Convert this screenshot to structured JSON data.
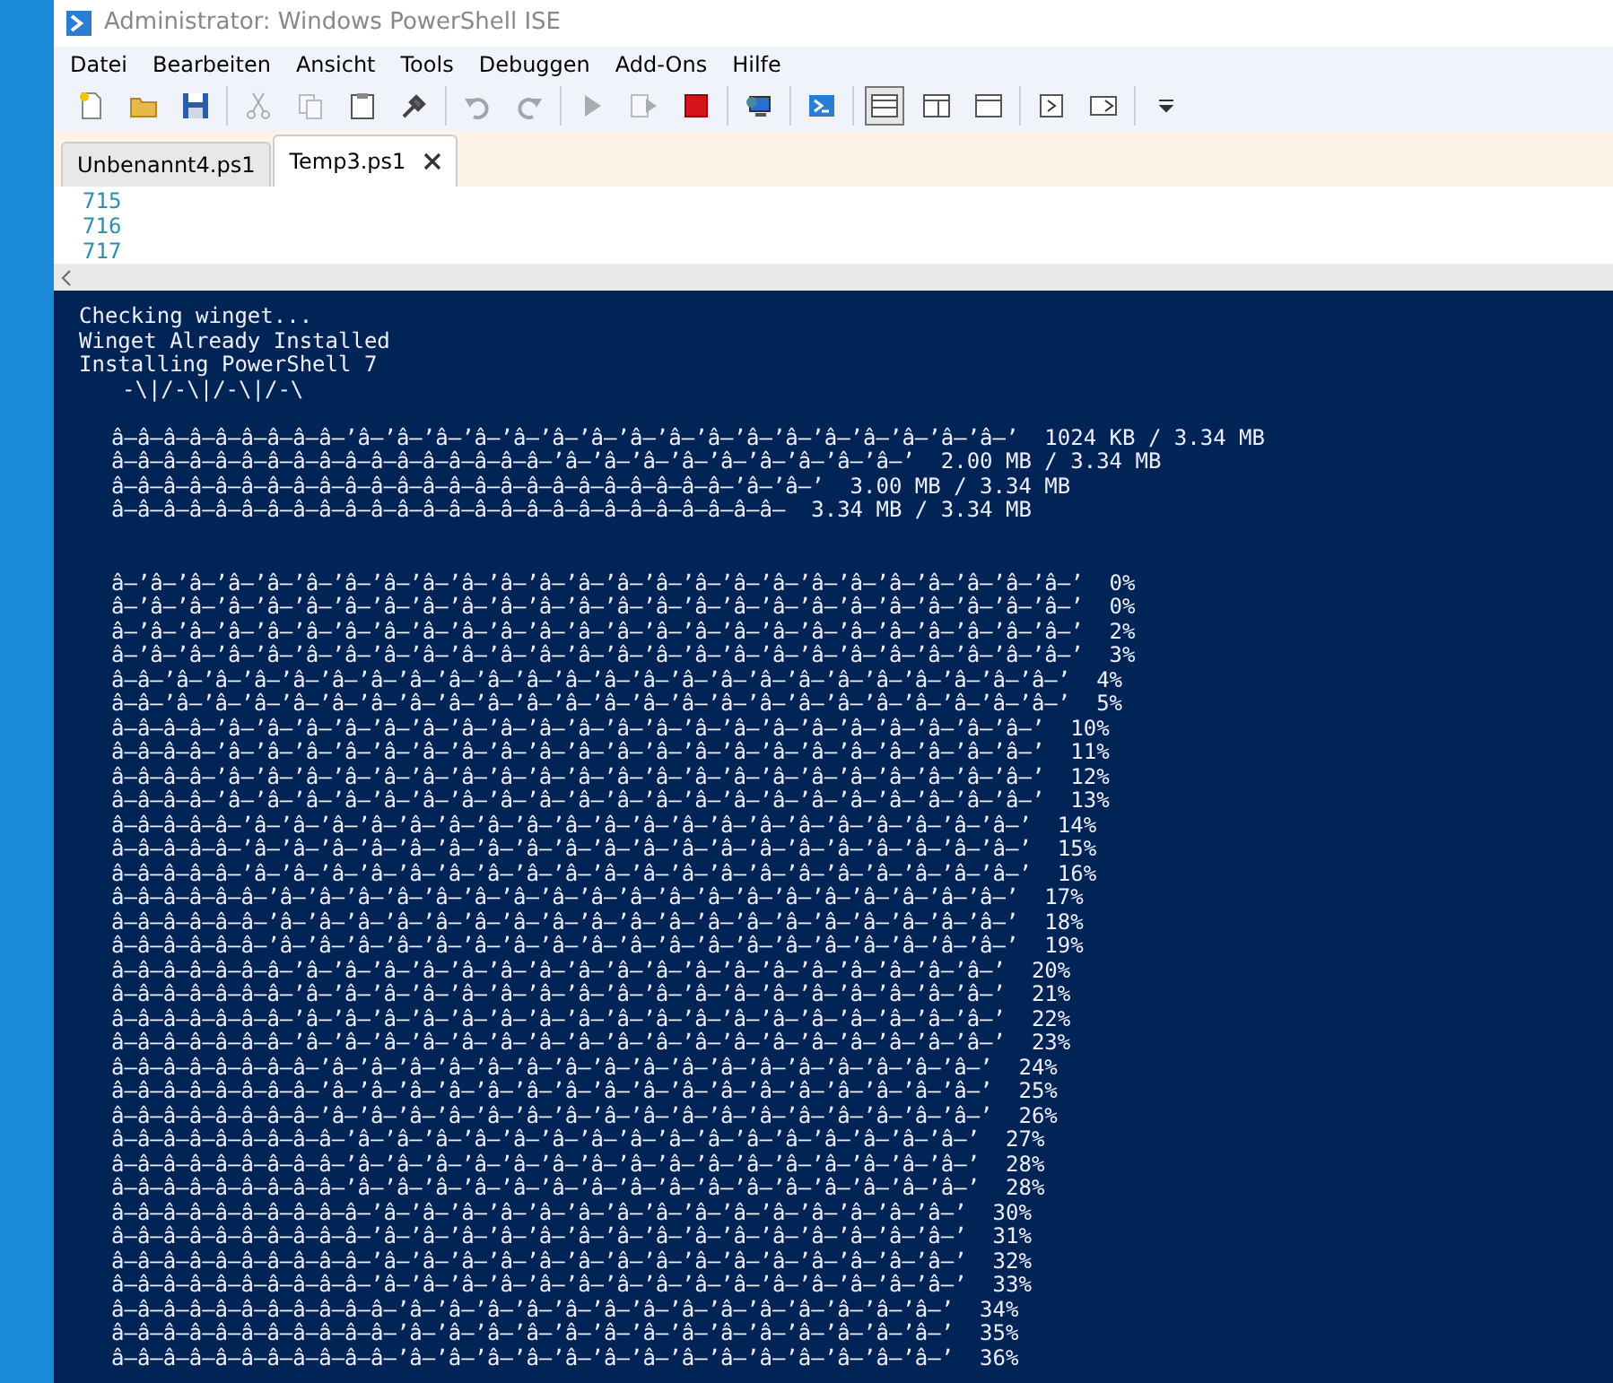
{
  "window": {
    "title": "Administrator: Windows PowerShell ISE"
  },
  "menu": [
    "Datei",
    "Bearbeiten",
    "Ansicht",
    "Tools",
    "Debuggen",
    "Add-Ons",
    "Hilfe"
  ],
  "toolbar": [
    [
      {
        "kind": "new",
        "disabled": false
      },
      {
        "kind": "open",
        "disabled": false
      },
      {
        "kind": "save",
        "disabled": false
      }
    ],
    [
      {
        "kind": "cut",
        "disabled": true
      },
      {
        "kind": "copy",
        "disabled": true
      },
      {
        "kind": "paste",
        "disabled": false
      },
      {
        "kind": "clear",
        "disabled": false
      }
    ],
    [
      {
        "kind": "undo",
        "disabled": true
      },
      {
        "kind": "redo",
        "disabled": true
      }
    ],
    [
      {
        "kind": "run",
        "disabled": true
      },
      {
        "kind": "runsel",
        "disabled": true
      },
      {
        "kind": "stop",
        "disabled": false
      }
    ],
    [
      {
        "kind": "remote",
        "disabled": false
      }
    ],
    [
      {
        "kind": "shell",
        "disabled": false
      }
    ],
    [
      {
        "kind": "layout-top",
        "disabled": false,
        "selected": true
      },
      {
        "kind": "layout-right",
        "disabled": false,
        "selected": false
      },
      {
        "kind": "layout-max",
        "disabled": false,
        "selected": false
      }
    ],
    [
      {
        "kind": "commands",
        "disabled": false
      },
      {
        "kind": "addon",
        "disabled": false
      }
    ],
    [
      {
        "kind": "overflow",
        "disabled": false
      }
    ]
  ],
  "tabs": [
    {
      "label": "Unbenannt4.ps1",
      "selected": false
    },
    {
      "label": "Temp3.ps1",
      "selected": true
    }
  ],
  "editor": {
    "line_numbers": [
      "715",
      "716",
      "717"
    ]
  },
  "console": {
    "lines": [
      {
        "kind": "text",
        "text": "Checking winget..."
      },
      {
        "kind": "text",
        "text": "Winget Already Installed"
      },
      {
        "kind": "text",
        "text": "Installing PowerShell 7"
      },
      {
        "kind": "spinner",
        "text": "-\\|/-\\|/-\\|/-\\"
      },
      {
        "kind": "blank"
      },
      {
        "kind": "bar",
        "text": "â–â–â–â–â–â–â–â–â–’â–’â–’â–’â–’â–’â–’â–’â–’â–’â–’â–’â–’â–’â–’â–’â–’â–’  1024 KB / 3.34 MB"
      },
      {
        "kind": "bar",
        "text": "â–â–â–â–â–â–â–â–â–â–â–â–â–â–â–â–â–’â–’â–’â–’â–’â–’â–’â–’â–’â–’  2.00 MB / 3.34 MB"
      },
      {
        "kind": "bar",
        "text": "â–â–â–â–â–â–â–â–â–â–â–â–â–â–â–â–â–â–â–â–â–â–â–â–’â–’â–’  3.00 MB / 3.34 MB"
      },
      {
        "kind": "bar",
        "text": "â–â–â–â–â–â–â–â–â–â–â–â–â–â–â–â–â–â–â–â–â–â–â–â–â–â–  3.34 MB / 3.34 MB"
      },
      {
        "kind": "blank"
      },
      {
        "kind": "blank"
      },
      {
        "kind": "bar",
        "text": "â–’â–’â–’â–’â–’â–’â–’â–’â–’â–’â–’â–’â–’â–’â–’â–’â–’â–’â–’â–’â–’â–’â–’â–’â–’  0%"
      },
      {
        "kind": "bar",
        "text": "â–’â–’â–’â–’â–’â–’â–’â–’â–’â–’â–’â–’â–’â–’â–’â–’â–’â–’â–’â–’â–’â–’â–’â–’â–’  0%"
      },
      {
        "kind": "bar",
        "text": "â–’â–’â–’â–’â–’â–’â–’â–’â–’â–’â–’â–’â–’â–’â–’â–’â–’â–’â–’â–’â–’â–’â–’â–’â–’  2%"
      },
      {
        "kind": "bar",
        "text": "â–’â–’â–’â–’â–’â–’â–’â–’â–’â–’â–’â–’â–’â–’â–’â–’â–’â–’â–’â–’â–’â–’â–’â–’â–’  3%"
      },
      {
        "kind": "bar",
        "text": "â–â–’â–’â–’â–’â–’â–’â–’â–’â–’â–’â–’â–’â–’â–’â–’â–’â–’â–’â–’â–’â–’â–’â–’â–’  4%"
      },
      {
        "kind": "bar",
        "text": "â–â–’â–’â–’â–’â–’â–’â–’â–’â–’â–’â–’â–’â–’â–’â–’â–’â–’â–’â–’â–’â–’â–’â–’â–’  5%"
      },
      {
        "kind": "bar",
        "text": "â–â–â–â–’â–’â–’â–’â–’â–’â–’â–’â–’â–’â–’â–’â–’â–’â–’â–’â–’â–’â–’â–’â–’â–’  10%"
      },
      {
        "kind": "bar",
        "text": "â–â–â–â–’â–’â–’â–’â–’â–’â–’â–’â–’â–’â–’â–’â–’â–’â–’â–’â–’â–’â–’â–’â–’â–’  11%"
      },
      {
        "kind": "bar",
        "text": "â–â–â–â–’â–’â–’â–’â–’â–’â–’â–’â–’â–’â–’â–’â–’â–’â–’â–’â–’â–’â–’â–’â–’â–’  12%"
      },
      {
        "kind": "bar",
        "text": "â–â–â–â–’â–’â–’â–’â–’â–’â–’â–’â–’â–’â–’â–’â–’â–’â–’â–’â–’â–’â–’â–’â–’â–’  13%"
      },
      {
        "kind": "bar",
        "text": "â–â–â–â–â–’â–’â–’â–’â–’â–’â–’â–’â–’â–’â–’â–’â–’â–’â–’â–’â–’â–’â–’â–’â–’  14%"
      },
      {
        "kind": "bar",
        "text": "â–â–â–â–â–’â–’â–’â–’â–’â–’â–’â–’â–’â–’â–’â–’â–’â–’â–’â–’â–’â–’â–’â–’â–’  15%"
      },
      {
        "kind": "bar",
        "text": "â–â–â–â–â–’â–’â–’â–’â–’â–’â–’â–’â–’â–’â–’â–’â–’â–’â–’â–’â–’â–’â–’â–’â–’  16%"
      },
      {
        "kind": "bar",
        "text": "â–â–â–â–â–â–’â–’â–’â–’â–’â–’â–’â–’â–’â–’â–’â–’â–’â–’â–’â–’â–’â–’â–’â–’  17%"
      },
      {
        "kind": "bar",
        "text": "â–â–â–â–â–â–’â–’â–’â–’â–’â–’â–’â–’â–’â–’â–’â–’â–’â–’â–’â–’â–’â–’â–’â–’  18%"
      },
      {
        "kind": "bar",
        "text": "â–â–â–â–â–â–’â–’â–’â–’â–’â–’â–’â–’â–’â–’â–’â–’â–’â–’â–’â–’â–’â–’â–’â–’  19%"
      },
      {
        "kind": "bar",
        "text": "â–â–â–â–â–â–â–’â–’â–’â–’â–’â–’â–’â–’â–’â–’â–’â–’â–’â–’â–’â–’â–’â–’â–’  20%"
      },
      {
        "kind": "bar",
        "text": "â–â–â–â–â–â–â–’â–’â–’â–’â–’â–’â–’â–’â–’â–’â–’â–’â–’â–’â–’â–’â–’â–’â–’  21%"
      },
      {
        "kind": "bar",
        "text": "â–â–â–â–â–â–â–’â–’â–’â–’â–’â–’â–’â–’â–’â–’â–’â–’â–’â–’â–’â–’â–’â–’â–’  22%"
      },
      {
        "kind": "bar",
        "text": "â–â–â–â–â–â–â–’â–’â–’â–’â–’â–’â–’â–’â–’â–’â–’â–’â–’â–’â–’â–’â–’â–’â–’  23%"
      },
      {
        "kind": "bar",
        "text": "â–â–â–â–â–â–â–â–’â–’â–’â–’â–’â–’â–’â–’â–’â–’â–’â–’â–’â–’â–’â–’â–’â–’  24%"
      },
      {
        "kind": "bar",
        "text": "â–â–â–â–â–â–â–â–’â–’â–’â–’â–’â–’â–’â–’â–’â–’â–’â–’â–’â–’â–’â–’â–’â–’  25%"
      },
      {
        "kind": "bar",
        "text": "â–â–â–â–â–â–â–â–’â–’â–’â–’â–’â–’â–’â–’â–’â–’â–’â–’â–’â–’â–’â–’â–’â–’  26%"
      },
      {
        "kind": "bar",
        "text": "â–â–â–â–â–â–â–â–â–’â–’â–’â–’â–’â–’â–’â–’â–’â–’â–’â–’â–’â–’â–’â–’â–’  27%"
      },
      {
        "kind": "bar",
        "text": "â–â–â–â–â–â–â–â–â–’â–’â–’â–’â–’â–’â–’â–’â–’â–’â–’â–’â–’â–’â–’â–’â–’  28%"
      },
      {
        "kind": "bar",
        "text": "â–â–â–â–â–â–â–â–â–’â–’â–’â–’â–’â–’â–’â–’â–’â–’â–’â–’â–’â–’â–’â–’â–’  28%"
      },
      {
        "kind": "bar",
        "text": "â–â–â–â–â–â–â–â–â–â–’â–’â–’â–’â–’â–’â–’â–’â–’â–’â–’â–’â–’â–’â–’â–’  30%"
      },
      {
        "kind": "bar",
        "text": "â–â–â–â–â–â–â–â–â–â–’â–’â–’â–’â–’â–’â–’â–’â–’â–’â–’â–’â–’â–’â–’â–’  31%"
      },
      {
        "kind": "bar",
        "text": "â–â–â–â–â–â–â–â–â–â–’â–’â–’â–’â–’â–’â–’â–’â–’â–’â–’â–’â–’â–’â–’â–’  32%"
      },
      {
        "kind": "bar",
        "text": "â–â–â–â–â–â–â–â–â–â–’â–’â–’â–’â–’â–’â–’â–’â–’â–’â–’â–’â–’â–’â–’â–’  33%"
      },
      {
        "kind": "bar",
        "text": "â–â–â–â–â–â–â–â–â–â–â–’â–’â–’â–’â–’â–’â–’â–’â–’â–’â–’â–’â–’â–’â–’  34%"
      },
      {
        "kind": "bar",
        "text": "â–â–â–â–â–â–â–â–â–â–â–’â–’â–’â–’â–’â–’â–’â–’â–’â–’â–’â–’â–’â–’â–’  35%"
      },
      {
        "kind": "bar",
        "text": "â–â–â–â–â–â–â–â–â–â–â–’â–’â–’â–’â–’â–’â–’â–’â–’â–’â–’â–’â–’â–’â–’  36%"
      }
    ]
  }
}
